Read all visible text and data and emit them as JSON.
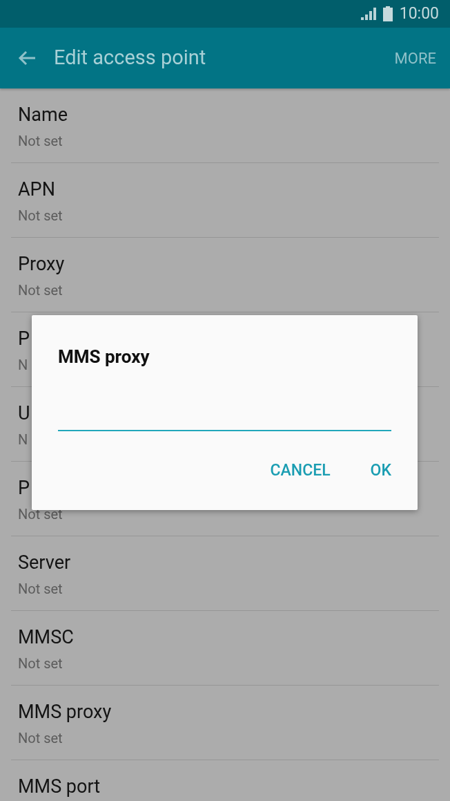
{
  "status_bar": {
    "time": "10:00"
  },
  "app_bar": {
    "title": "Edit access point",
    "action": "MORE"
  },
  "settings": [
    {
      "title": "Name",
      "value": "Not set"
    },
    {
      "title": "APN",
      "value": "Not set"
    },
    {
      "title": "Proxy",
      "value": "Not set"
    },
    {
      "title": "P",
      "value": "N"
    },
    {
      "title": "U",
      "value": "N"
    },
    {
      "title": "P",
      "value": "Not set"
    },
    {
      "title": "Server",
      "value": "Not set"
    },
    {
      "title": "MMSC",
      "value": "Not set"
    },
    {
      "title": "MMS proxy",
      "value": "Not set"
    },
    {
      "title": "MMS port"
    }
  ],
  "dialog": {
    "title": "MMS proxy",
    "buttons": [
      "CANCEL",
      "OK"
    ]
  }
}
